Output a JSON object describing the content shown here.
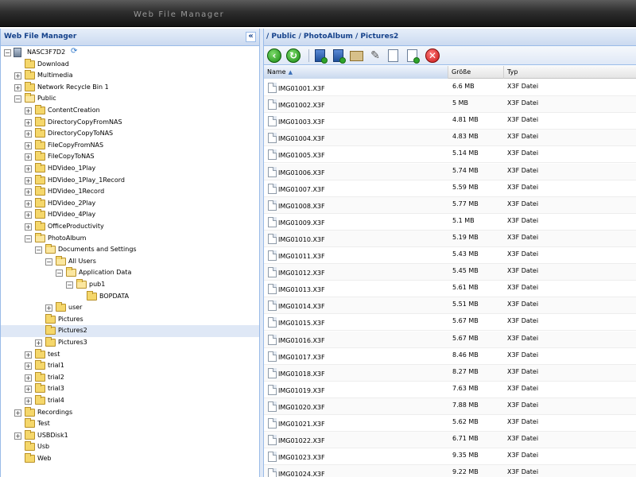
{
  "app": {
    "title": "Web File Manager"
  },
  "left_panel": {
    "title": "Web File Manager",
    "collapse_glyph": "«",
    "tree": [
      {
        "label": "NASC3F7D2",
        "kind": "nas",
        "depth": 0,
        "toggle": "−"
      },
      {
        "label": "Download",
        "kind": "folder",
        "depth": 1,
        "toggle": ""
      },
      {
        "label": "Multimedia",
        "kind": "folder",
        "depth": 1,
        "toggle": "+"
      },
      {
        "label": "Network Recycle Bin 1",
        "kind": "folder",
        "depth": 1,
        "toggle": "+"
      },
      {
        "label": "Public",
        "kind": "folder-open",
        "depth": 1,
        "toggle": "−"
      },
      {
        "label": "ContentCreation",
        "kind": "folder",
        "depth": 2,
        "toggle": "+"
      },
      {
        "label": "DirectoryCopyFromNAS",
        "kind": "folder",
        "depth": 2,
        "toggle": "+"
      },
      {
        "label": "DirectoryCopyToNAS",
        "kind": "folder",
        "depth": 2,
        "toggle": "+"
      },
      {
        "label": "FileCopyFromNAS",
        "kind": "folder",
        "depth": 2,
        "toggle": "+"
      },
      {
        "label": "FileCopyToNAS",
        "kind": "folder",
        "depth": 2,
        "toggle": "+"
      },
      {
        "label": "HDVideo_1Play",
        "kind": "folder",
        "depth": 2,
        "toggle": "+"
      },
      {
        "label": "HDVideo_1Play_1Record",
        "kind": "folder",
        "depth": 2,
        "toggle": "+"
      },
      {
        "label": "HDVideo_1Record",
        "kind": "folder",
        "depth": 2,
        "toggle": "+"
      },
      {
        "label": "HDVideo_2Play",
        "kind": "folder",
        "depth": 2,
        "toggle": "+"
      },
      {
        "label": "HDVideo_4Play",
        "kind": "folder",
        "depth": 2,
        "toggle": "+"
      },
      {
        "label": "OfficeProductivity",
        "kind": "folder",
        "depth": 2,
        "toggle": "+"
      },
      {
        "label": "PhotoAlbum",
        "kind": "folder-open",
        "depth": 2,
        "toggle": "−"
      },
      {
        "label": "Documents and Settings",
        "kind": "folder-open",
        "depth": 3,
        "toggle": "−"
      },
      {
        "label": "All Users",
        "kind": "folder-open",
        "depth": 4,
        "toggle": "−"
      },
      {
        "label": "Application Data",
        "kind": "folder-open",
        "depth": 5,
        "toggle": "−"
      },
      {
        "label": "pub1",
        "kind": "folder-open",
        "depth": 6,
        "toggle": "−"
      },
      {
        "label": "BOPDATA",
        "kind": "folder",
        "depth": 7,
        "toggle": ""
      },
      {
        "label": "user",
        "kind": "folder",
        "depth": 4,
        "toggle": "+"
      },
      {
        "label": "Pictures",
        "kind": "folder",
        "depth": 3,
        "toggle": ""
      },
      {
        "label": "Pictures2",
        "kind": "folder",
        "depth": 3,
        "toggle": "",
        "selected": true
      },
      {
        "label": "Pictures3",
        "kind": "folder",
        "depth": 3,
        "toggle": "+"
      },
      {
        "label": "test",
        "kind": "folder",
        "depth": 2,
        "toggle": "+"
      },
      {
        "label": "trial1",
        "kind": "folder",
        "depth": 2,
        "toggle": "+"
      },
      {
        "label": "trial2",
        "kind": "folder",
        "depth": 2,
        "toggle": "+"
      },
      {
        "label": "trial3",
        "kind": "folder",
        "depth": 2,
        "toggle": "+"
      },
      {
        "label": "trial4",
        "kind": "folder",
        "depth": 2,
        "toggle": "+"
      },
      {
        "label": "Recordings",
        "kind": "folder",
        "depth": 1,
        "toggle": "+"
      },
      {
        "label": "Test",
        "kind": "folder",
        "depth": 1,
        "toggle": ""
      },
      {
        "label": "USBDisk1",
        "kind": "folder",
        "depth": 1,
        "toggle": "+"
      },
      {
        "label": "Usb",
        "kind": "folder",
        "depth": 1,
        "toggle": ""
      },
      {
        "label": "Web",
        "kind": "folder",
        "depth": 1,
        "toggle": ""
      }
    ]
  },
  "right_panel": {
    "breadcrumb": "/ Public / PhotoAlbum / Pictures2",
    "toolbar": [
      {
        "name": "back-icon",
        "glyph": "‹"
      },
      {
        "name": "refresh-icon",
        "glyph": "↻"
      },
      {
        "name": "upload-file-icon",
        "glyph": ""
      },
      {
        "name": "download-file-icon",
        "glyph": ""
      },
      {
        "name": "new-folder-icon",
        "glyph": ""
      },
      {
        "name": "rename-icon",
        "glyph": "✎"
      },
      {
        "name": "copy-icon",
        "glyph": ""
      },
      {
        "name": "move-icon",
        "glyph": ""
      },
      {
        "name": "delete-icon",
        "glyph": "✕"
      }
    ],
    "columns": {
      "name": "Name",
      "size": "Größe",
      "type": "Typ"
    },
    "files": [
      {
        "name": "IMG01001.X3F",
        "size": "6.6 MB",
        "type": "X3F Datei"
      },
      {
        "name": "IMG01002.X3F",
        "size": "5 MB",
        "type": "X3F Datei"
      },
      {
        "name": "IMG01003.X3F",
        "size": "4.81 MB",
        "type": "X3F Datei"
      },
      {
        "name": "IMG01004.X3F",
        "size": "4.83 MB",
        "type": "X3F Datei"
      },
      {
        "name": "IMG01005.X3F",
        "size": "5.14 MB",
        "type": "X3F Datei"
      },
      {
        "name": "IMG01006.X3F",
        "size": "5.74 MB",
        "type": "X3F Datei"
      },
      {
        "name": "IMG01007.X3F",
        "size": "5.59 MB",
        "type": "X3F Datei"
      },
      {
        "name": "IMG01008.X3F",
        "size": "5.77 MB",
        "type": "X3F Datei"
      },
      {
        "name": "IMG01009.X3F",
        "size": "5.1 MB",
        "type": "X3F Datei"
      },
      {
        "name": "IMG01010.X3F",
        "size": "5.19 MB",
        "type": "X3F Datei"
      },
      {
        "name": "IMG01011.X3F",
        "size": "5.43 MB",
        "type": "X3F Datei"
      },
      {
        "name": "IMG01012.X3F",
        "size": "5.45 MB",
        "type": "X3F Datei"
      },
      {
        "name": "IMG01013.X3F",
        "size": "5.61 MB",
        "type": "X3F Datei"
      },
      {
        "name": "IMG01014.X3F",
        "size": "5.51 MB",
        "type": "X3F Datei"
      },
      {
        "name": "IMG01015.X3F",
        "size": "5.67 MB",
        "type": "X3F Datei"
      },
      {
        "name": "IMG01016.X3F",
        "size": "5.67 MB",
        "type": "X3F Datei"
      },
      {
        "name": "IMG01017.X3F",
        "size": "8.46 MB",
        "type": "X3F Datei"
      },
      {
        "name": "IMG01018.X3F",
        "size": "8.27 MB",
        "type": "X3F Datei"
      },
      {
        "name": "IMG01019.X3F",
        "size": "7.63 MB",
        "type": "X3F Datei"
      },
      {
        "name": "IMG01020.X3F",
        "size": "7.88 MB",
        "type": "X3F Datei"
      },
      {
        "name": "IMG01021.X3F",
        "size": "5.62 MB",
        "type": "X3F Datei"
      },
      {
        "name": "IMG01022.X3F",
        "size": "6.71 MB",
        "type": "X3F Datei"
      },
      {
        "name": "IMG01023.X3F",
        "size": "9.35 MB",
        "type": "X3F Datei"
      },
      {
        "name": "IMG01024.X3F",
        "size": "9.22 MB",
        "type": "X3F Datei"
      }
    ]
  }
}
